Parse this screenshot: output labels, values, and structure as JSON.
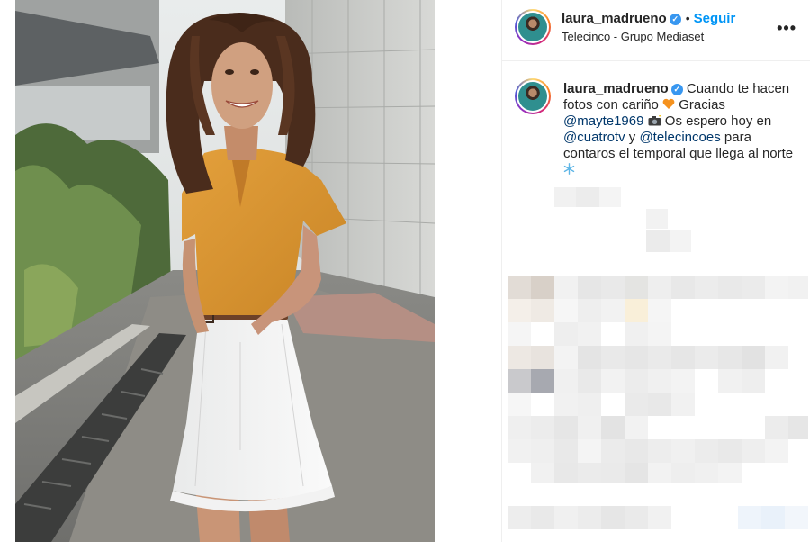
{
  "header": {
    "username": "laura_madrueno",
    "verified_mark": "✓",
    "separator": "•",
    "follow_label": "Seguir",
    "location": "Telecinco - Grupo Mediaset",
    "more_label": "•••"
  },
  "caption": {
    "username": "laura_madrueno",
    "text_1": " Cuando te hacen fotos con cariño ",
    "text_2": " Gracias ",
    "mention_1": "@mayte1969",
    "text_3": " Os espero hoy en ",
    "mention_2": "@cuatrotv",
    "text_4": " y ",
    "mention_3": "@telecincoes",
    "text_5": " para contaros el temporal que llega al norte "
  },
  "icons": {
    "avatar": "avatar",
    "verified": "verified-badge-icon",
    "heart": "orange-heart-emoji",
    "camera": "camera-flash-emoji",
    "snowflake": "snowflake-emoji",
    "more": "more-options-icon"
  },
  "colors": {
    "follow": "#0095f6",
    "mention": "#00376b",
    "verified": "#3897f0",
    "text": "#262626"
  }
}
